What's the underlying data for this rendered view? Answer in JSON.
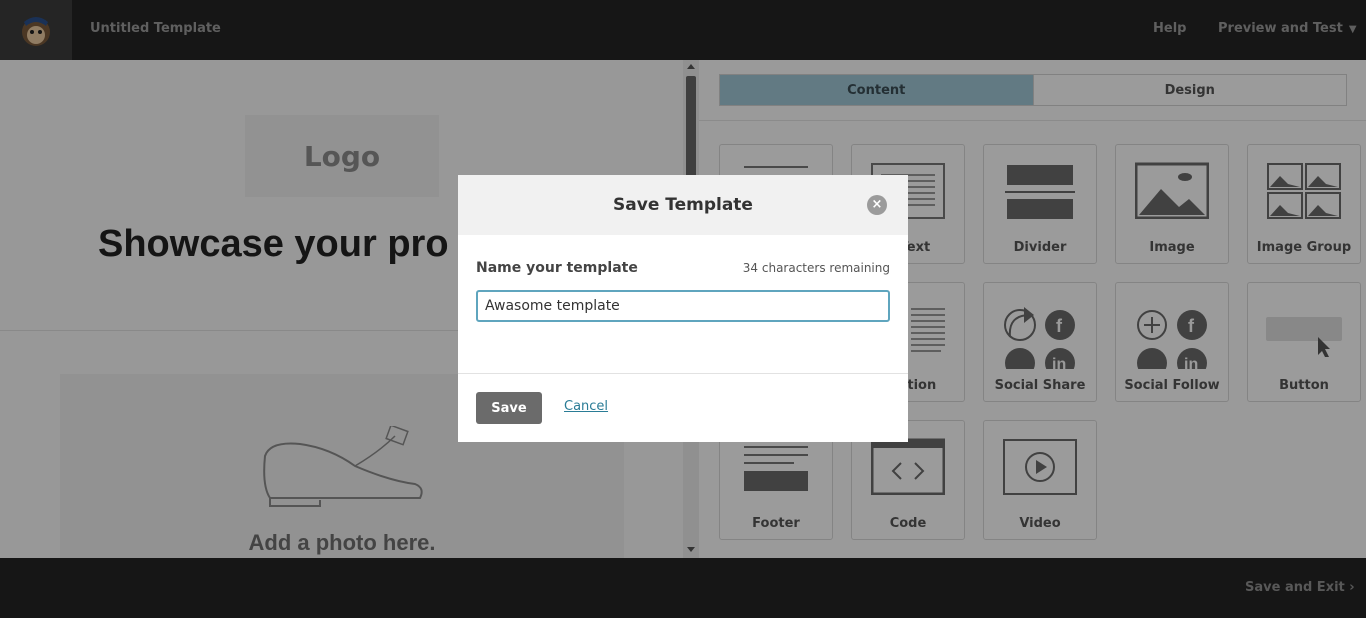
{
  "header": {
    "title": "Untitled Template",
    "help": "Help",
    "preview": "Preview and Test"
  },
  "canvas": {
    "logo_placeholder": "Logo",
    "headline": "Showcase your pro",
    "photo_placeholder": "Add a photo here."
  },
  "panel": {
    "tabs": [
      {
        "label": "Content",
        "active": true
      },
      {
        "label": "Design",
        "active": false
      }
    ],
    "blocks": [
      {
        "label": "",
        "icon": "text-icon"
      },
      {
        "label": "d Text",
        "icon": "boxed-text-icon"
      },
      {
        "label": "Divider",
        "icon": "divider-icon"
      },
      {
        "label": "Image",
        "icon": "image-icon"
      },
      {
        "label": "Image Group",
        "icon": "image-group-icon"
      },
      {
        "label": "",
        "icon": "image-card-icon"
      },
      {
        "label": "Caption",
        "icon": "image-caption-icon"
      },
      {
        "label": "Social Share",
        "icon": "social-share-icon"
      },
      {
        "label": "Social Follow",
        "icon": "social-follow-icon"
      },
      {
        "label": "Button",
        "icon": "button-icon"
      },
      {
        "label": "Footer",
        "icon": "footer-icon"
      },
      {
        "label": "Code",
        "icon": "code-icon"
      },
      {
        "label": "Video",
        "icon": "video-icon"
      }
    ]
  },
  "footer": {
    "save_exit": "Save and Exit"
  },
  "modal": {
    "title": "Save Template",
    "field_label": "Name your template",
    "remaining": "34 characters remaining",
    "input_value": "Awasome template",
    "save": "Save",
    "cancel": "Cancel",
    "close": "×"
  },
  "colors": {
    "accent": "#9fc6d3",
    "input_border": "#5fa5be",
    "link": "#2a7c96"
  }
}
